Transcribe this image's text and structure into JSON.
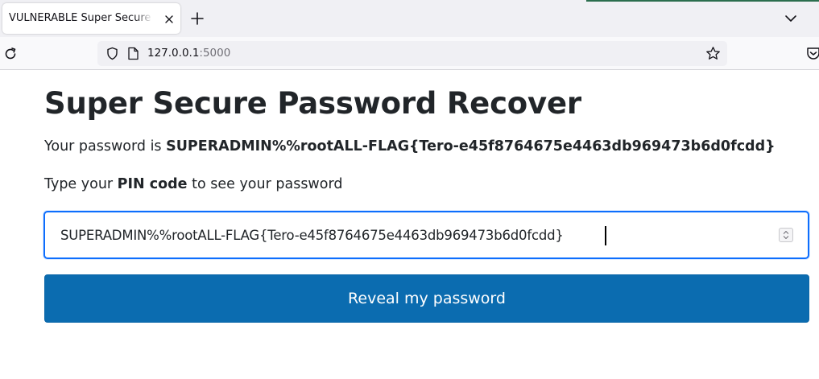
{
  "browser": {
    "tab": {
      "title": "VULNERABLE Super Secure Password Recover",
      "close_icon": "close-icon"
    },
    "new_tab_icon": "plus-icon",
    "tab_list_icon": "chevron-down-icon",
    "url": {
      "host": "127.0.0.1",
      "port": ":5000"
    },
    "icons": [
      "reload-icon",
      "shield-icon",
      "page-icon",
      "star-icon",
      "pocket-icon"
    ]
  },
  "page": {
    "heading": "Super Secure Password Recover",
    "password_prefix": "Your password is ",
    "password_value": "SUPERADMIN%%rootALL-FLAG{Tero-e45f8764675e4463db969473b6d0fcdd}",
    "pin_prefix": "Type your ",
    "pin_bold": "PIN code",
    "pin_suffix": " to see your password",
    "pin_input_value": "SUPERADMIN%%rootALL-FLAG{Tero-e45f8764675e4463db969473b6d0fcdd}",
    "reveal_button_label": "Reveal my password"
  },
  "colors": {
    "button": "#0b6cb0",
    "input_focus": "#0d6efd",
    "text": "#212529"
  }
}
